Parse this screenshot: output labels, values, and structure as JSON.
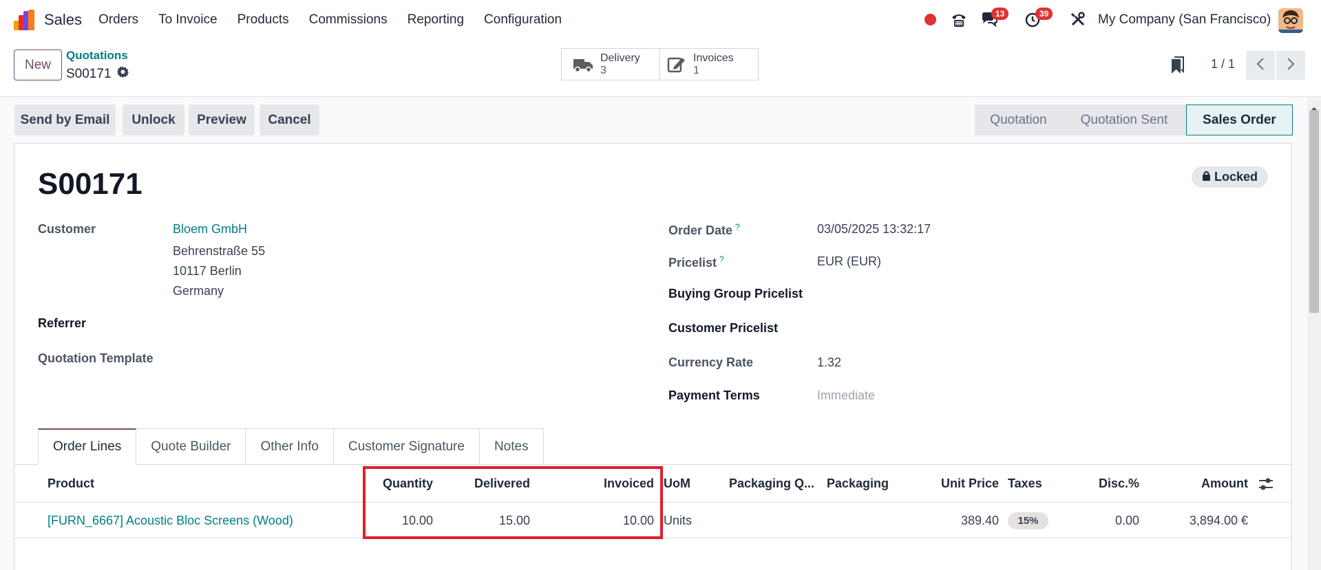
{
  "topnav": {
    "app_name": "Sales",
    "menu": [
      "Orders",
      "To Invoice",
      "Products",
      "Commissions",
      "Reporting",
      "Configuration"
    ],
    "messages_badge": "13",
    "activities_badge": "39",
    "company": "My Company (San Francisco)",
    "brand_colors": [
      "#f59f00",
      "#e03131",
      "#7048e8",
      "#fd7e14"
    ]
  },
  "controlpanel": {
    "new_label": "New",
    "breadcrumb_parent": "Quotations",
    "breadcrumb_current": "S00171",
    "smart_buttons": [
      {
        "label": "Delivery",
        "value": "3",
        "icon": "truck-icon"
      },
      {
        "label": "Invoices",
        "value": "1",
        "icon": "edit-invoice-icon"
      }
    ],
    "pager": "1 / 1"
  },
  "actions": [
    "Send by Email",
    "Unlock",
    "Preview",
    "Cancel"
  ],
  "statusbar": {
    "stages": [
      "Quotation",
      "Quotation Sent",
      "Sales Order"
    ],
    "active": "Sales Order"
  },
  "form": {
    "title": "S00171",
    "locked_label": "Locked",
    "customer_label": "Customer",
    "customer_name": "Bloem GmbH",
    "customer_street": "Behrenstraße 55",
    "customer_city": "10117 Berlin",
    "customer_country": "Germany",
    "referrer_label": "Referrer",
    "quotation_template_label": "Quotation Template",
    "order_date_label": "Order Date",
    "order_date_value": "03/05/2025 13:32:17",
    "pricelist_label": "Pricelist",
    "pricelist_value": "EUR (EUR)",
    "buying_group_label": "Buying Group Pricelist",
    "customer_pricelist_label": "Customer Pricelist",
    "currency_rate_label": "Currency Rate",
    "currency_rate_value": "1.32",
    "payment_terms_label": "Payment Terms",
    "payment_terms_value": "Immediate",
    "help_mark": "?"
  },
  "tabs": [
    "Order Lines",
    "Quote Builder",
    "Other Info",
    "Customer Signature",
    "Notes"
  ],
  "table": {
    "headers": {
      "product": "Product",
      "quantity": "Quantity",
      "delivered": "Delivered",
      "invoiced": "Invoiced",
      "uom": "UoM",
      "packaging_qty": "Packaging Q...",
      "packaging": "Packaging",
      "unit_price": "Unit Price",
      "taxes": "Taxes",
      "disc": "Disc.%",
      "amount": "Amount"
    },
    "rows": [
      {
        "product": "[FURN_6667] Acoustic Bloc Screens (Wood)",
        "quantity": "10.00",
        "delivered": "15.00",
        "invoiced": "10.00",
        "uom": "Units",
        "unit_price": "389.40",
        "taxes": "15%",
        "disc": "0.00",
        "amount": "3,894.00 €"
      }
    ]
  }
}
